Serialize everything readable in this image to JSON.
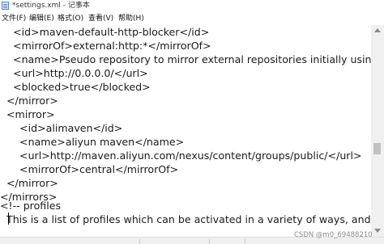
{
  "window": {
    "title": "*settings.xml - 记事本"
  },
  "menu": [
    "文件(F)",
    "编辑(E)",
    "格式(O)",
    "查看(V)",
    "帮助(H)"
  ],
  "editor": {
    "lines": [
      "    <id>maven-default-http-blocker</id>",
      "    <mirrorOf>external:http:*</mirrorOf>",
      "    <name>Pseudo repository to mirror external repositories initially using HTTP",
      "    <url>http://0.0.0.0/</url>",
      "    <blocked>true</blocked>",
      "  </mirror>",
      "  <mirror>",
      "      <id>alimaven</id>",
      "      <name>aliyun maven</name>",
      "      <url>http://maven.aliyun.com/nexus/content/groups/public/</url>",
      "      <mirrorOf>central</mirrorOf>",
      "  </mirror>",
      "</mirrors>",
      "",
      "<!-- profiles",
      "  This is a list of profiles which can be activated in a variety of ways, and which c"
    ]
  },
  "watermark": "CSDN @m0_69488210"
}
